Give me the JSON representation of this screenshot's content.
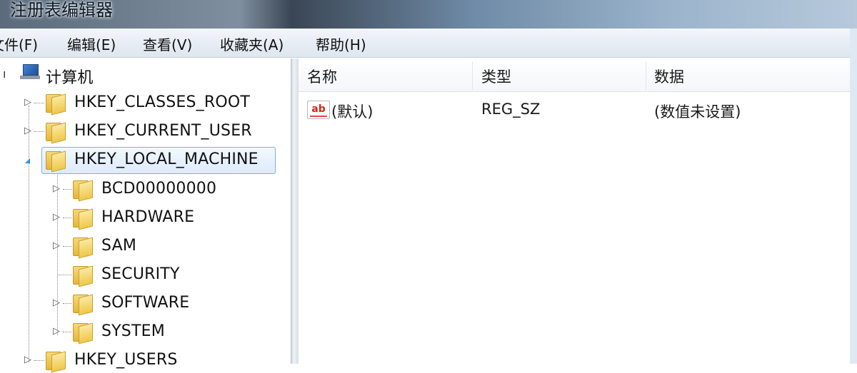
{
  "window": {
    "title": "注册表编辑器"
  },
  "menu": [
    "文件(F)",
    "编辑(E)",
    "查看(V)",
    "收藏夹(A)",
    "帮助(H)"
  ],
  "tree": {
    "root": "计算机",
    "hives": [
      "HKEY_CLASSES_ROOT",
      "HKEY_CURRENT_USER",
      "HKEY_LOCAL_MACHINE",
      "HKEY_USERS"
    ],
    "local_machine_children": [
      "BCD00000000",
      "HARDWARE",
      "SAM",
      "SECURITY",
      "SOFTWARE",
      "SYSTEM"
    ],
    "selected": "HKEY_LOCAL_MACHINE"
  },
  "list": {
    "columns": [
      "名称",
      "类型",
      "数据"
    ],
    "rows": [
      {
        "name": "(默认)",
        "type": "REG_SZ",
        "data": "(数值未设置)",
        "icon": "reg-string-ab-icon"
      }
    ]
  },
  "icons": {
    "root": "computer-icon",
    "hive": "folder-icon",
    "expand": "triangle-right-icon",
    "expanded": "triangle-down-icon"
  },
  "colors": {
    "selection_border": "#7fb0e8",
    "folder": "#e5b739",
    "ab_icon": "#d62418"
  }
}
